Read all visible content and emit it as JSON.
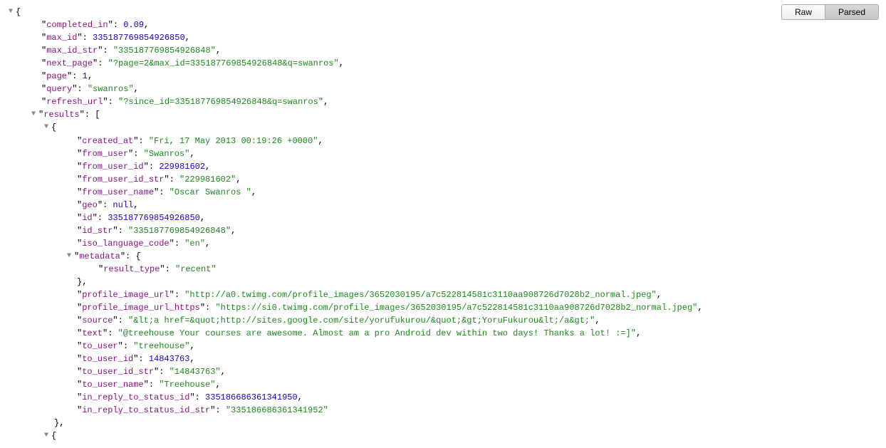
{
  "toolbar": {
    "raw_label": "Raw",
    "parsed_label": "Parsed"
  },
  "json": {
    "completed_in_key": "completed_in",
    "completed_in_val": "0.09",
    "max_id_key": "max_id",
    "max_id_val": "335187769854926850",
    "max_id_str_key": "max_id_str",
    "max_id_str_val": "\"335187769854926848\"",
    "next_page_key": "next_page",
    "next_page_val": "\"?page=2&max_id=335187769854926848&q=swanros\"",
    "page_key": "page",
    "page_val": "1",
    "query_key": "query",
    "query_val": "\"swanros\"",
    "refresh_url_key": "refresh_url",
    "refresh_url_val": "\"?since_id=335187769854926848&q=swanros\"",
    "results_key": "results",
    "r0": {
      "created_at_key": "created_at",
      "created_at_val": "\"Fri, 17 May 2013 00:19:26 +0000\"",
      "from_user_key": "from_user",
      "from_user_val": "\"Swanros\"",
      "from_user_id_key": "from_user_id",
      "from_user_id_val": "229981602",
      "from_user_id_str_key": "from_user_id_str",
      "from_user_id_str_val": "\"229981602\"",
      "from_user_name_key": "from_user_name",
      "from_user_name_val": "\"Oscar Swanros \"",
      "geo_key": "geo",
      "geo_val": "null",
      "id_key": "id",
      "id_val": "335187769854926850",
      "id_str_key": "id_str",
      "id_str_val": "\"335187769854926848\"",
      "iso_lang_key": "iso_language_code",
      "iso_lang_val": "\"en\"",
      "metadata_key": "metadata",
      "metadata_result_type_key": "result_type",
      "metadata_result_type_val": "\"recent\"",
      "profile_image_url_key": "profile_image_url",
      "profile_image_url_val": "\"http://a0.twimg.com/profile_images/3652030195/a7c522814581c3110aa908726d7028b2_normal.jpeg\"",
      "profile_image_url_https_key": "profile_image_url_https",
      "profile_image_url_https_val": "\"https://si0.twimg.com/profile_images/3652030195/a7c522814581c3110aa908726d7028b2_normal.jpeg\"",
      "source_key": "source",
      "source_val": "\"&lt;a href=&quot;http://sites.google.com/site/yorufukurou/&quot;&gt;YoruFukurou&lt;/a&gt;\"",
      "text_key": "text",
      "text_val": "\"@treehouse Your courses are awesome. Almost am a pro Android dev within two days! Thanks a lot! :=]\"",
      "to_user_key": "to_user",
      "to_user_val": "\"treehouse\"",
      "to_user_id_key": "to_user_id",
      "to_user_id_val": "14843763",
      "to_user_id_str_key": "to_user_id_str",
      "to_user_id_str_val": "\"14843763\"",
      "to_user_name_key": "to_user_name",
      "to_user_name_val": "\"Treehouse\"",
      "in_reply_to_status_id_key": "in_reply_to_status_id",
      "in_reply_to_status_id_val": "335186686361341950",
      "in_reply_to_status_id_str_key": "in_reply_to_status_id_str",
      "in_reply_to_status_id_str_val": "\"335186686361341952\""
    }
  }
}
